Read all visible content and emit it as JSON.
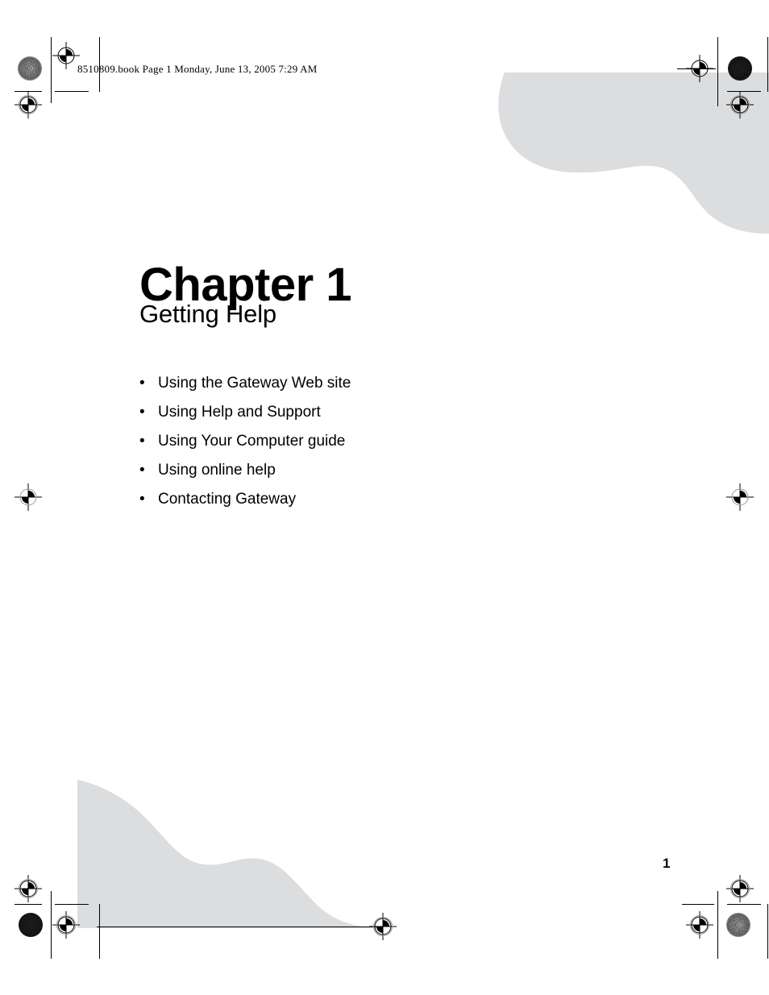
{
  "document": {
    "header_line": "8510809.book  Page 1  Monday, June 13, 2005  7:29 AM",
    "chapter_title": "Chapter 1",
    "chapter_subtitle": "Getting Help",
    "page_number": "1",
    "bullet_glyph": "•",
    "accent_gray": "#dcdddf"
  },
  "topics": [
    {
      "label": "Using the Gateway Web site"
    },
    {
      "label": "Using Help and Support"
    },
    {
      "label": "Using Your Computer guide"
    },
    {
      "label": "Using online help"
    },
    {
      "label": "Contacting Gateway"
    }
  ],
  "print_marks": {
    "registration_mark_name": "registration-crosshair",
    "density_patch_name": "density-patch-circle"
  }
}
